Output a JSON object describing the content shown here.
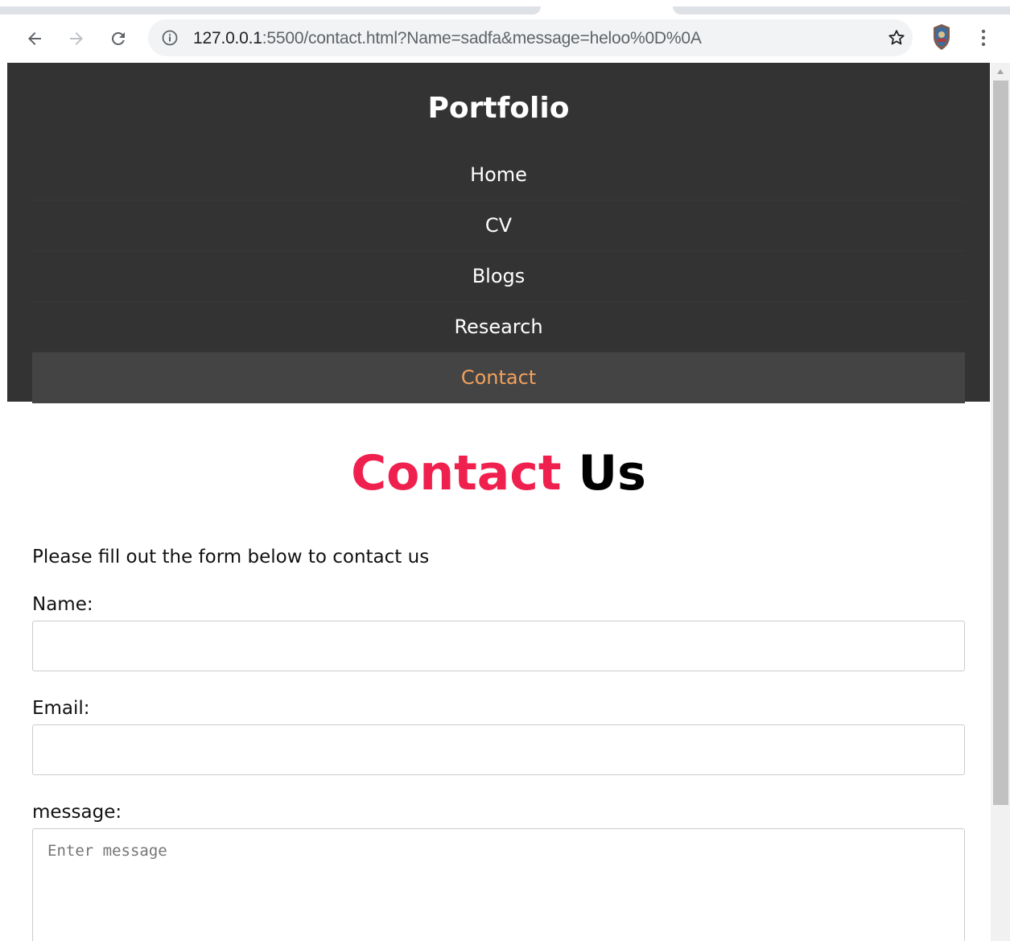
{
  "browser": {
    "url_host": "127.0.0.1",
    "url_rest": ":5500/contact.html?Name=sadfa&message=heloo%0D%0A",
    "icons": {
      "back": "arrow-left-icon",
      "forward": "arrow-right-icon",
      "reload": "reload-icon",
      "info": "info-icon",
      "bookmark": "star-icon",
      "profile": "avatar",
      "menu": "more-vertical-icon"
    }
  },
  "site": {
    "brand": "Portfolio",
    "nav": [
      {
        "label": "Home",
        "active": false
      },
      {
        "label": "CV",
        "active": false
      },
      {
        "label": "Blogs",
        "active": false
      },
      {
        "label": "Research",
        "active": false
      },
      {
        "label": "Contact",
        "active": true
      }
    ],
    "colors": {
      "header_bg": "#333333",
      "active_nav_bg": "#444444",
      "active_nav_text": "#f2a15c",
      "title_accent": "#f0204e"
    }
  },
  "page": {
    "title_accent": "Contact",
    "title_rest": "Us",
    "intro": "Please fill out the form below to contact us",
    "form": {
      "name_label": "Name:",
      "name_value": "",
      "email_label": "Email:",
      "email_value": "",
      "message_label": "message:",
      "message_placeholder": "Enter message"
    }
  }
}
